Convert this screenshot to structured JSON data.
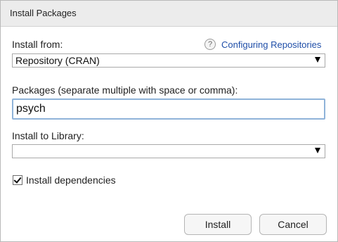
{
  "dialog": {
    "title": "Install Packages"
  },
  "install_from": {
    "label": "Install from:",
    "help_icon": "question-icon",
    "help_glyph": "?",
    "help_link": "Configuring Repositories",
    "selected": "Repository (CRAN)"
  },
  "packages": {
    "label": "Packages (separate multiple with space or comma):",
    "value": "psych"
  },
  "library": {
    "label": "Install to Library:",
    "selected": ""
  },
  "dependencies": {
    "label": "Install dependencies",
    "checked": true
  },
  "buttons": {
    "install": "Install",
    "cancel": "Cancel"
  }
}
